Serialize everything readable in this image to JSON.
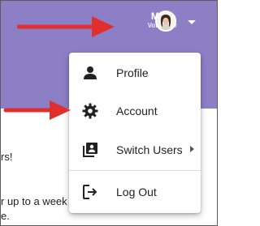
{
  "header": {
    "user_name": "Mary",
    "user_role": "Volunteer"
  },
  "background_text": {
    "line1": "rs!",
    "line2": "r up to a week",
    "line3": "e."
  },
  "menu": {
    "items": [
      {
        "label": "Profile",
        "icon": "person-icon"
      },
      {
        "label": "Account",
        "icon": "gear-icon"
      },
      {
        "label": "Switch Users",
        "icon": "switch-users-icon",
        "has_submenu": true
      },
      {
        "label": "Log Out",
        "icon": "logout-icon"
      }
    ]
  },
  "colors": {
    "header_bg": "#8c7fc6",
    "arrow": "#e02f2f",
    "menu_bg": "#ffffff"
  }
}
